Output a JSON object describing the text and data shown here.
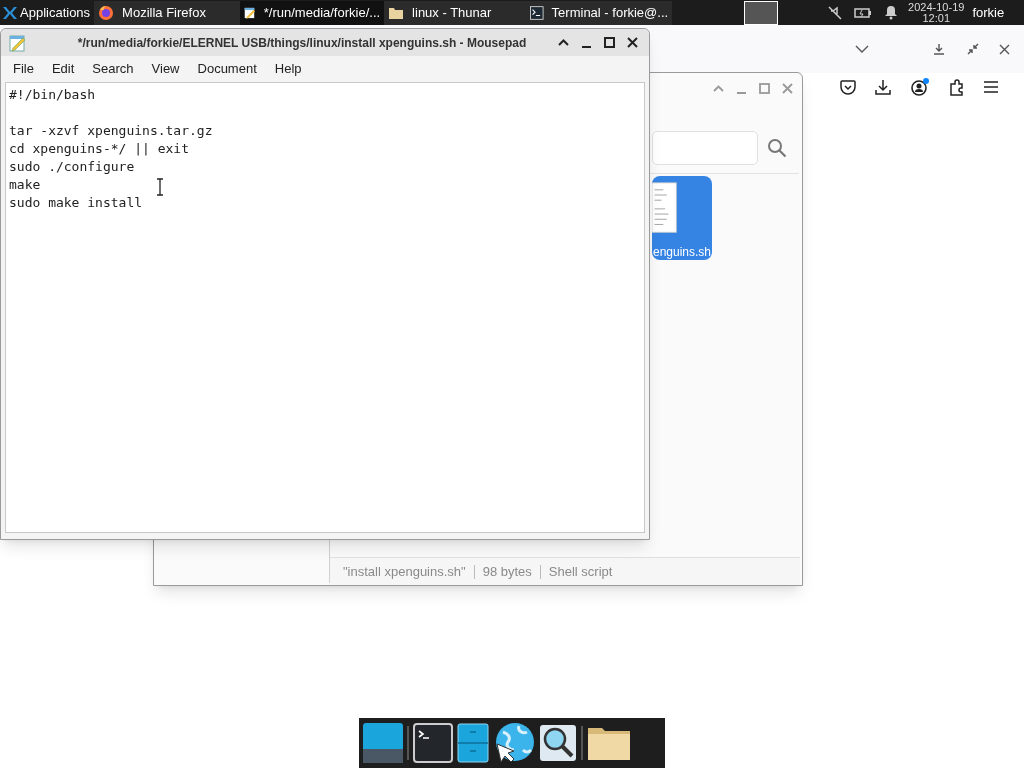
{
  "panel": {
    "apps_menu": "Applications",
    "tasks": [
      {
        "title": "Mozilla Firefox",
        "kind": "firefox",
        "selected": false
      },
      {
        "title": "*/run/media/forkie/...",
        "kind": "editor",
        "selected": true
      },
      {
        "title": "linux - Thunar",
        "kind": "folder",
        "selected": false
      },
      {
        "title": "Terminal - forkie@...",
        "kind": "terminal",
        "selected": false
      }
    ],
    "clock": {
      "date": "2024-10-19",
      "time": "12:01"
    },
    "user": "forkie"
  },
  "editor": {
    "title": "*/run/media/forkie/ELERNEL USB/things/linux/install xpenguins.sh - Mousepad",
    "menu": [
      "File",
      "Edit",
      "Search",
      "View",
      "Document",
      "Help"
    ],
    "lines": [
      {
        "kind": "code",
        "text": "#!/bin/bash"
      },
      {
        "kind": "blank"
      },
      {
        "kind": "code",
        "text": "tar -xzvf xpenguins.tar.gz"
      },
      {
        "kind": "code",
        "text": "cd xpenguins-*/ || exit"
      },
      {
        "kind": "code",
        "text": "sudo ./configure"
      },
      {
        "kind": "code",
        "text": "make"
      },
      {
        "kind": "code",
        "text": "sudo make install"
      }
    ]
  },
  "file_manager": {
    "file": {
      "name": "enguins.sh",
      "selected": true
    },
    "status": [
      "\"install xpenguins.sh\"",
      "98 bytes",
      "Shell script"
    ]
  },
  "dock": [
    {
      "kind": "desktop"
    },
    {
      "kind": "terminal"
    },
    {
      "kind": "files"
    },
    {
      "kind": "browser"
    },
    {
      "kind": "search"
    },
    {
      "kind": "folder"
    }
  ]
}
